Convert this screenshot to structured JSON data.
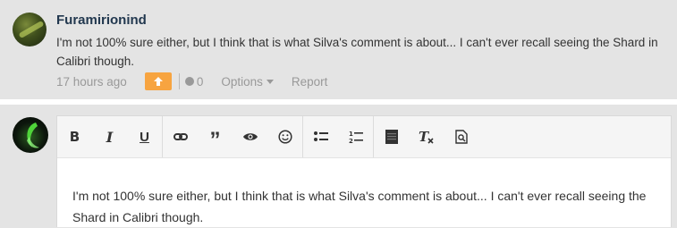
{
  "comment": {
    "username": "Furamirionind",
    "text": "I'm not 100% sure either, but I think that is what Silva's comment is about... I can't ever recall seeing the Shard in Calibri though.",
    "time": "17 hours ago",
    "upvote_icon": "arrow-up-icon",
    "reply_count": "0",
    "options_label": "Options",
    "report_label": "Report",
    "accent_color": "#f7a440"
  },
  "editor": {
    "toolbar": {
      "bold": "B",
      "italic": "I",
      "underline": "U",
      "link_icon": "link-icon",
      "quote": "”",
      "preview_icon": "eye-icon",
      "emoji_icon": "smiley-icon",
      "bullet_list_icon": "bullet-list-icon",
      "numbered_list_icon": "numbered-list-icon",
      "spoiler_icon": "spoiler-icon",
      "clear_format_icon": "clear-format-icon",
      "search_icon": "find-icon"
    },
    "content": "I'm not 100% sure either, but I think that is what Silva's comment is about... I can't ever recall seeing the Shard in Calibri though."
  }
}
